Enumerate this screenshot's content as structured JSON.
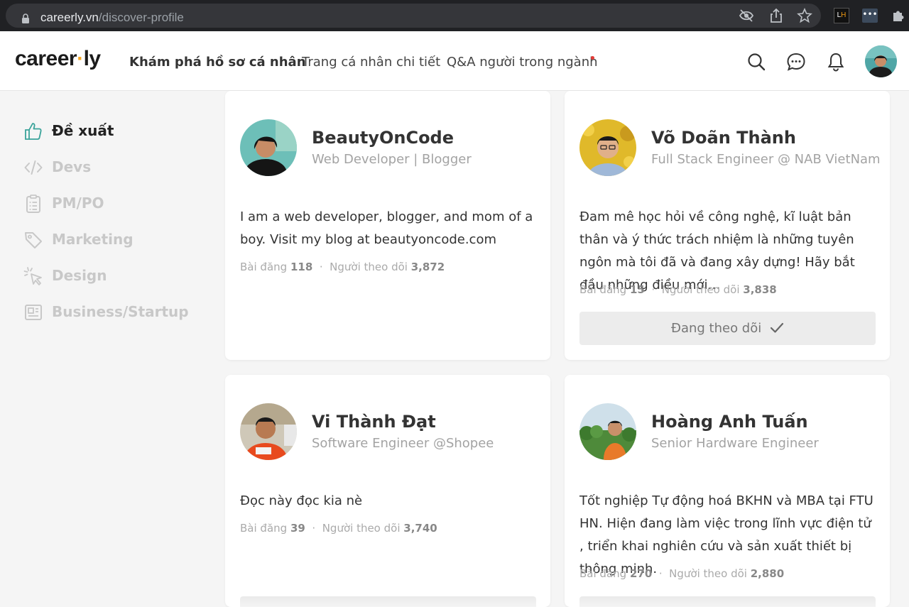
{
  "browser": {
    "url_domain": "careerly.vn",
    "url_path": "/discover-profile",
    "ext_lh": "LH",
    "ext_dots": "•••"
  },
  "header": {
    "logo": "career·ly",
    "nav": [
      {
        "label": "Khám phá hồ sơ cá nhân",
        "active": true
      },
      {
        "label": "Trang cá nhân chi tiết",
        "active": false
      },
      {
        "label": "Q&A người trong ngành",
        "active": false
      }
    ]
  },
  "sidebar": {
    "items": [
      {
        "label": "Đề xuất",
        "icon": "thumbs-up-icon",
        "active": true
      },
      {
        "label": "Devs",
        "icon": "code-icon",
        "active": false
      },
      {
        "label": "PM/PO",
        "icon": "clipboard-icon",
        "active": false
      },
      {
        "label": "Marketing",
        "icon": "tag-icon",
        "active": false
      },
      {
        "label": "Design",
        "icon": "cursor-click-icon",
        "active": false
      },
      {
        "label": "Business/Startup",
        "icon": "newspaper-icon",
        "active": false
      }
    ]
  },
  "colors": {
    "accent": "#3aa39a",
    "notification": "#e53935",
    "logo_dot": "#f5a623"
  },
  "stats_labels": {
    "posts": "Bài đăng",
    "followers": "Người theo dõi",
    "sep": "·"
  },
  "profiles": [
    {
      "name": "BeautyOnCode",
      "role": "Web Developer | Blogger",
      "bio": "I am a web developer, blogger, and mom of a boy. Visit my blog at beautyoncode.com",
      "posts": "118",
      "followers": "3,872",
      "following_label": ""
    },
    {
      "name": "Võ Doãn Thành",
      "role": "Full Stack Engineer @ NAB VietNam",
      "bio": "Đam mê học hỏi về công nghệ, kĩ luật bản thân và ý thức trách nhiệm là những tuyên ngôn mà tôi đã và đang xây dựng! Hãy bắt đầu những điều mới…",
      "posts": "15",
      "followers": "3,838",
      "following_label": "Đang theo dõi"
    },
    {
      "name": "Vi Thành Đạt",
      "role": "Software Engineer @Shopee",
      "bio": "Đọc này đọc kia nè",
      "posts": "39",
      "followers": "3,740",
      "following_label": ""
    },
    {
      "name": "Hoàng Anh Tuấn",
      "role": "Senior Hardware Engineer",
      "bio": "Tốt nghiệp Tự động hoá BKHN và MBA tại FTU HN. Hiện đang làm việc trong lĩnh vực điện tử , triển khai nghiên cứu và sản xuất thiết bị thông minh.",
      "posts": "270",
      "followers": "2,880",
      "following_label": ""
    }
  ]
}
